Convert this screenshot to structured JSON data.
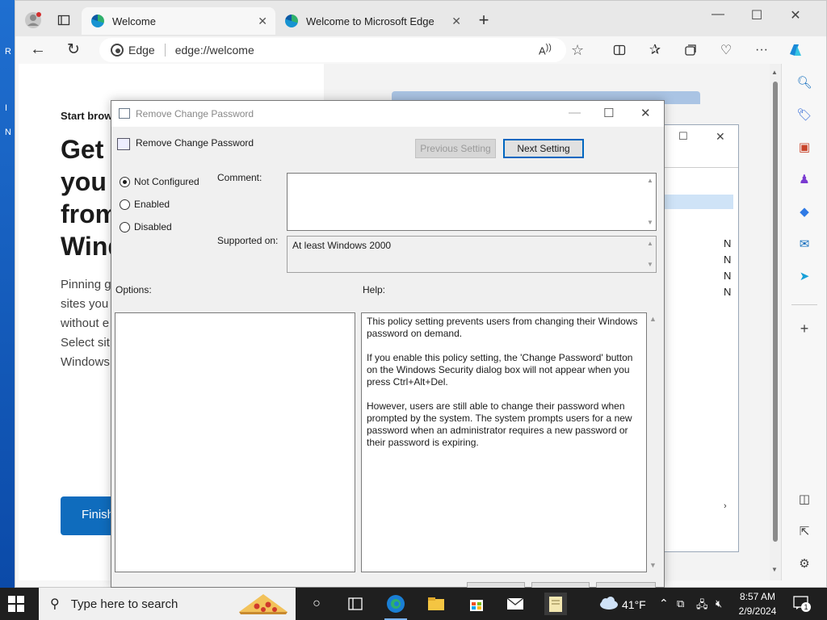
{
  "desktop": {
    "edge_letters": [
      "R",
      "I",
      "N"
    ]
  },
  "browser": {
    "tabs": [
      {
        "label": "Welcome",
        "active": true
      },
      {
        "label": "Welcome to Microsoft Edge",
        "active": false
      }
    ],
    "new_tab_symbol": "+",
    "address": {
      "site_label": "Edge",
      "url": "edge://welcome"
    },
    "page": {
      "start_browsing": "Start brow",
      "title_lines": [
        "Get",
        "you",
        "from",
        "Wind"
      ],
      "pinning_lines": [
        "Pinning g",
        "sites you",
        "without e",
        "Select sit",
        "Windows"
      ],
      "finish_button": "Finish"
    }
  },
  "background_dialog": {
    "rows": [
      "N",
      "N",
      "N",
      "N"
    ]
  },
  "dialog": {
    "window_title": "Remove Change Password",
    "setting_name": "Remove Change Password",
    "prev_button": "Previous Setting",
    "next_button": "Next Setting",
    "radios": [
      {
        "label": "Not Configured",
        "checked": true
      },
      {
        "label": "Enabled",
        "checked": false
      },
      {
        "label": "Disabled",
        "checked": false
      }
    ],
    "comment_label": "Comment:",
    "supported_label": "Supported on:",
    "supported_value": "At least Windows 2000",
    "options_label": "Options:",
    "help_label": "Help:",
    "help_paragraphs": [
      "This policy setting prevents users from changing their Windows password on demand.",
      "If you enable this policy setting,  the 'Change Password' button on the Windows Security dialog box will not appear when you press Ctrl+Alt+Del.",
      "However, users are still able to change their password when prompted by the system. The system prompts users for a new password when an administrator requires a new password or their password is expiring."
    ]
  },
  "taskbar": {
    "search_placeholder": "Type here to search",
    "weather": "41°F",
    "time": "8:57 AM",
    "date": "2/9/2024",
    "notification_count": "1"
  }
}
